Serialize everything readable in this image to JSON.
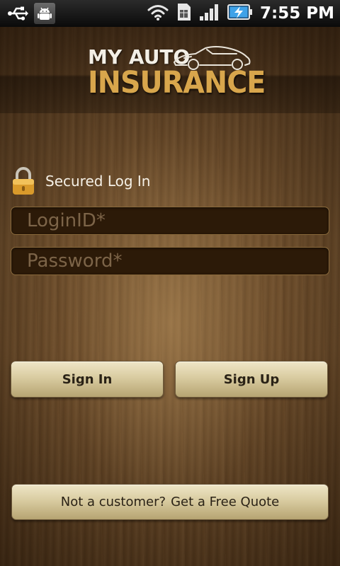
{
  "status_bar": {
    "time": "7:55 PM",
    "icons": [
      "usb-icon",
      "android-debug-icon",
      "wifi-icon",
      "sim-icon",
      "signal-icon",
      "battery-charging-icon"
    ]
  },
  "logo": {
    "line1": "MY AUTO",
    "line2": "INSURANCE"
  },
  "secured": {
    "label": "Secured Log In",
    "icon": "lock-icon"
  },
  "form": {
    "login_placeholder": "LoginID*",
    "login_value": "",
    "password_placeholder": "Password*",
    "password_value": ""
  },
  "buttons": {
    "sign_in": "Sign In",
    "sign_up": "Sign Up"
  },
  "quote": {
    "prompt": "Not a customer?",
    "link": "Get a Free Quote"
  },
  "colors": {
    "logo_gold": "#d8a64c",
    "field_bg": "#2c1a08",
    "button_cream": "#d9cca1"
  }
}
